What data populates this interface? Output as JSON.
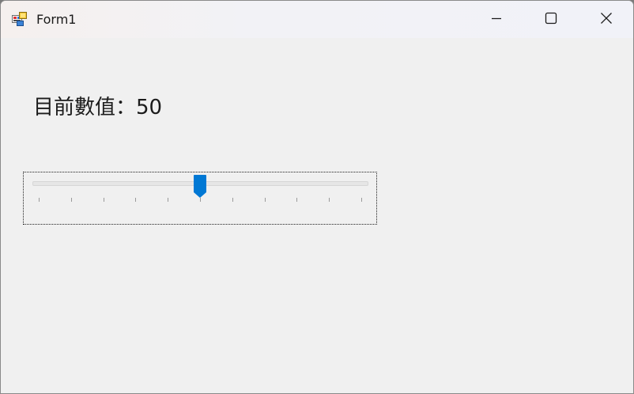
{
  "window": {
    "title": "Form1",
    "icon": "winforms-app-icon"
  },
  "caption_buttons": {
    "minimize": "minimize-icon",
    "maximize": "maximize-icon",
    "close": "close-icon"
  },
  "label": {
    "text": "目前數值：50"
  },
  "trackbar": {
    "value": 50,
    "minimum": 0,
    "maximum": 100,
    "tick_frequency": 10,
    "accent_color": "#0078d4"
  }
}
